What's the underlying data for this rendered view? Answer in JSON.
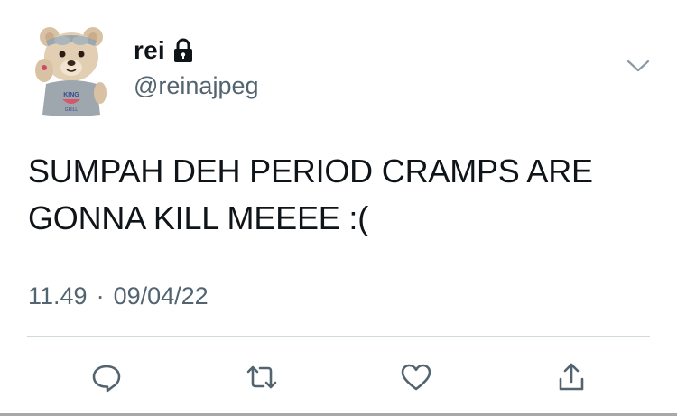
{
  "tweet": {
    "author": {
      "display_name": "rei",
      "handle": "@reinajpeg",
      "protected": true,
      "avatar": {
        "shirt_text_line1": "KING",
        "shirt_text_line2": "GRILL"
      }
    },
    "text_line1": "SUMPAH DEH PERIOD CRAMPS ARE",
    "text_line2": "GONNA KILL MEEEE :(",
    "time": "11.49",
    "separator": "·",
    "date": "09/04/22"
  },
  "icons": {
    "lock": "lock-icon",
    "chevron": "chevron-down-icon",
    "reply": "reply-icon",
    "retweet": "retweet-icon",
    "like": "heart-icon",
    "share": "share-icon"
  },
  "colors": {
    "text": "#0f1419",
    "secondary_text": "#536471",
    "divider": "#cfd9de"
  }
}
